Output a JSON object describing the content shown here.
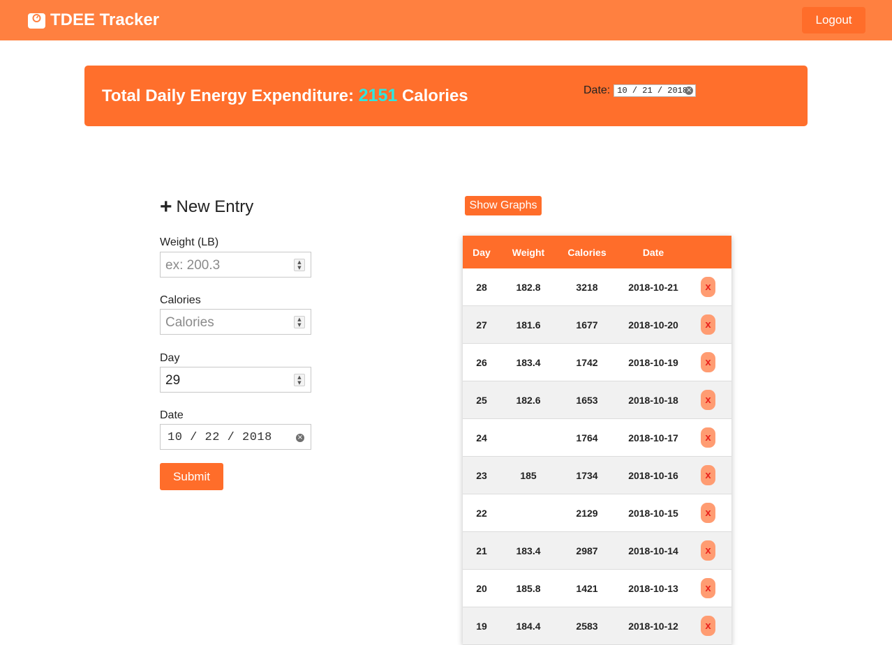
{
  "app": {
    "brand": "TDEE Tracker",
    "logout_label": "Logout"
  },
  "banner": {
    "title_prefix": "Total Daily Energy Expenditure:",
    "tdee_value": "2151",
    "title_suffix": "Calories",
    "date_label": "Date:",
    "date_value": "10 / 21 / 2018"
  },
  "form": {
    "heading": "New Entry",
    "weight_label": "Weight (LB)",
    "weight_placeholder": "ex: 200.3",
    "calories_label": "Calories",
    "calories_placeholder": "Calories",
    "day_label": "Day",
    "day_value": "29",
    "date_label": "Date",
    "date_value": "10 / 22 / 2018",
    "submit_label": "Submit"
  },
  "table": {
    "show_graphs_label": "Show Graphs",
    "headers": [
      "Day",
      "Weight",
      "Calories",
      "Date"
    ],
    "delete_label": "x",
    "rows": [
      {
        "day": "28",
        "weight": "182.8",
        "calories": "3218",
        "date": "2018-10-21"
      },
      {
        "day": "27",
        "weight": "181.6",
        "calories": "1677",
        "date": "2018-10-20"
      },
      {
        "day": "26",
        "weight": "183.4",
        "calories": "1742",
        "date": "2018-10-19"
      },
      {
        "day": "25",
        "weight": "182.6",
        "calories": "1653",
        "date": "2018-10-18"
      },
      {
        "day": "24",
        "weight": "",
        "calories": "1764",
        "date": "2018-10-17"
      },
      {
        "day": "23",
        "weight": "185",
        "calories": "1734",
        "date": "2018-10-16"
      },
      {
        "day": "22",
        "weight": "",
        "calories": "2129",
        "date": "2018-10-15"
      },
      {
        "day": "21",
        "weight": "183.4",
        "calories": "2987",
        "date": "2018-10-14"
      },
      {
        "day": "20",
        "weight": "185.8",
        "calories": "1421",
        "date": "2018-10-13"
      },
      {
        "day": "19",
        "weight": "184.4",
        "calories": "2583",
        "date": "2018-10-12"
      }
    ]
  },
  "colors": {
    "navbar": "#ff8040",
    "accent": "#ff6d2a",
    "tdee_value": "#2ee6e0",
    "delete_text": "#e8231e"
  }
}
